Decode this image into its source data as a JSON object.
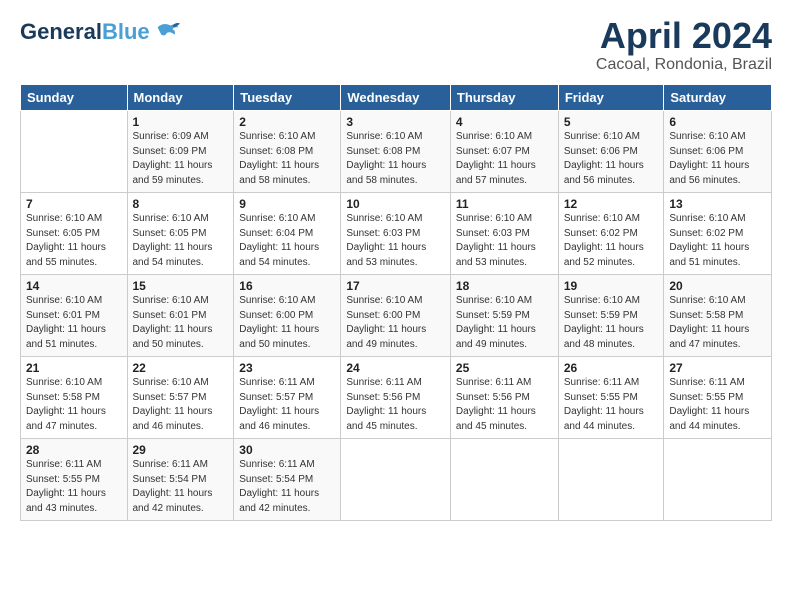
{
  "header": {
    "logo_line1": "General",
    "logo_line2": "Blue",
    "month": "April 2024",
    "location": "Cacoal, Rondonia, Brazil"
  },
  "days_of_week": [
    "Sunday",
    "Monday",
    "Tuesday",
    "Wednesday",
    "Thursday",
    "Friday",
    "Saturday"
  ],
  "weeks": [
    [
      {
        "day": "",
        "info": ""
      },
      {
        "day": "1",
        "info": "Sunrise: 6:09 AM\nSunset: 6:09 PM\nDaylight: 11 hours\nand 59 minutes."
      },
      {
        "day": "2",
        "info": "Sunrise: 6:10 AM\nSunset: 6:08 PM\nDaylight: 11 hours\nand 58 minutes."
      },
      {
        "day": "3",
        "info": "Sunrise: 6:10 AM\nSunset: 6:08 PM\nDaylight: 11 hours\nand 58 minutes."
      },
      {
        "day": "4",
        "info": "Sunrise: 6:10 AM\nSunset: 6:07 PM\nDaylight: 11 hours\nand 57 minutes."
      },
      {
        "day": "5",
        "info": "Sunrise: 6:10 AM\nSunset: 6:06 PM\nDaylight: 11 hours\nand 56 minutes."
      },
      {
        "day": "6",
        "info": "Sunrise: 6:10 AM\nSunset: 6:06 PM\nDaylight: 11 hours\nand 56 minutes."
      }
    ],
    [
      {
        "day": "7",
        "info": "Sunrise: 6:10 AM\nSunset: 6:05 PM\nDaylight: 11 hours\nand 55 minutes."
      },
      {
        "day": "8",
        "info": "Sunrise: 6:10 AM\nSunset: 6:05 PM\nDaylight: 11 hours\nand 54 minutes."
      },
      {
        "day": "9",
        "info": "Sunrise: 6:10 AM\nSunset: 6:04 PM\nDaylight: 11 hours\nand 54 minutes."
      },
      {
        "day": "10",
        "info": "Sunrise: 6:10 AM\nSunset: 6:03 PM\nDaylight: 11 hours\nand 53 minutes."
      },
      {
        "day": "11",
        "info": "Sunrise: 6:10 AM\nSunset: 6:03 PM\nDaylight: 11 hours\nand 53 minutes."
      },
      {
        "day": "12",
        "info": "Sunrise: 6:10 AM\nSunset: 6:02 PM\nDaylight: 11 hours\nand 52 minutes."
      },
      {
        "day": "13",
        "info": "Sunrise: 6:10 AM\nSunset: 6:02 PM\nDaylight: 11 hours\nand 51 minutes."
      }
    ],
    [
      {
        "day": "14",
        "info": "Sunrise: 6:10 AM\nSunset: 6:01 PM\nDaylight: 11 hours\nand 51 minutes."
      },
      {
        "day": "15",
        "info": "Sunrise: 6:10 AM\nSunset: 6:01 PM\nDaylight: 11 hours\nand 50 minutes."
      },
      {
        "day": "16",
        "info": "Sunrise: 6:10 AM\nSunset: 6:00 PM\nDaylight: 11 hours\nand 50 minutes."
      },
      {
        "day": "17",
        "info": "Sunrise: 6:10 AM\nSunset: 6:00 PM\nDaylight: 11 hours\nand 49 minutes."
      },
      {
        "day": "18",
        "info": "Sunrise: 6:10 AM\nSunset: 5:59 PM\nDaylight: 11 hours\nand 49 minutes."
      },
      {
        "day": "19",
        "info": "Sunrise: 6:10 AM\nSunset: 5:59 PM\nDaylight: 11 hours\nand 48 minutes."
      },
      {
        "day": "20",
        "info": "Sunrise: 6:10 AM\nSunset: 5:58 PM\nDaylight: 11 hours\nand 47 minutes."
      }
    ],
    [
      {
        "day": "21",
        "info": "Sunrise: 6:10 AM\nSunset: 5:58 PM\nDaylight: 11 hours\nand 47 minutes."
      },
      {
        "day": "22",
        "info": "Sunrise: 6:10 AM\nSunset: 5:57 PM\nDaylight: 11 hours\nand 46 minutes."
      },
      {
        "day": "23",
        "info": "Sunrise: 6:11 AM\nSunset: 5:57 PM\nDaylight: 11 hours\nand 46 minutes."
      },
      {
        "day": "24",
        "info": "Sunrise: 6:11 AM\nSunset: 5:56 PM\nDaylight: 11 hours\nand 45 minutes."
      },
      {
        "day": "25",
        "info": "Sunrise: 6:11 AM\nSunset: 5:56 PM\nDaylight: 11 hours\nand 45 minutes."
      },
      {
        "day": "26",
        "info": "Sunrise: 6:11 AM\nSunset: 5:55 PM\nDaylight: 11 hours\nand 44 minutes."
      },
      {
        "day": "27",
        "info": "Sunrise: 6:11 AM\nSunset: 5:55 PM\nDaylight: 11 hours\nand 44 minutes."
      }
    ],
    [
      {
        "day": "28",
        "info": "Sunrise: 6:11 AM\nSunset: 5:55 PM\nDaylight: 11 hours\nand 43 minutes."
      },
      {
        "day": "29",
        "info": "Sunrise: 6:11 AM\nSunset: 5:54 PM\nDaylight: 11 hours\nand 42 minutes."
      },
      {
        "day": "30",
        "info": "Sunrise: 6:11 AM\nSunset: 5:54 PM\nDaylight: 11 hours\nand 42 minutes."
      },
      {
        "day": "",
        "info": ""
      },
      {
        "day": "",
        "info": ""
      },
      {
        "day": "",
        "info": ""
      },
      {
        "day": "",
        "info": ""
      }
    ]
  ]
}
